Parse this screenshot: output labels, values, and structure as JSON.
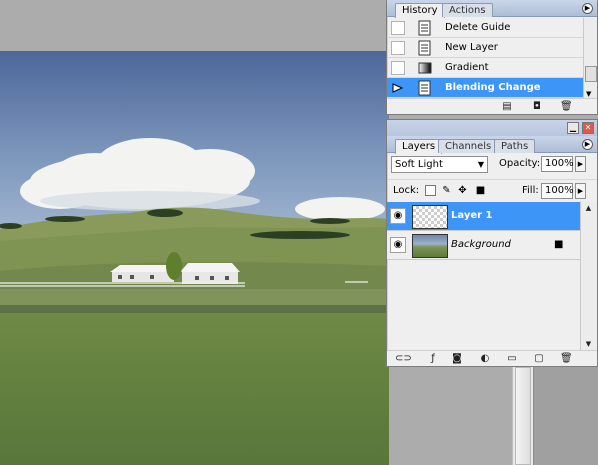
{
  "history": {
    "tabs": [
      "History",
      "Actions"
    ],
    "items": [
      {
        "label": "Delete Guide",
        "active": false
      },
      {
        "label": "New Layer",
        "active": false
      },
      {
        "label": "Gradient",
        "active": false
      },
      {
        "label": "Blending Change",
        "active": true
      }
    ],
    "menu_icon": "panel-menu-icon"
  },
  "layers": {
    "tabs": [
      "Layers",
      "Channels",
      "Paths"
    ],
    "blend_mode": "Soft Light",
    "opacity_label": "Opacity:",
    "opacity_value": "100%",
    "lock_label": "Lock:",
    "fill_label": "Fill:",
    "fill_value": "100%",
    "items": [
      {
        "name": "Layer 1",
        "active": true,
        "thumb": "transparent"
      },
      {
        "name": "Background",
        "active": false,
        "thumb": "landscape",
        "locked": true
      }
    ]
  },
  "colors": {
    "selection": "#3d95f7",
    "panel_bg": "#efefef",
    "tab_bar": "#aebdd6"
  }
}
